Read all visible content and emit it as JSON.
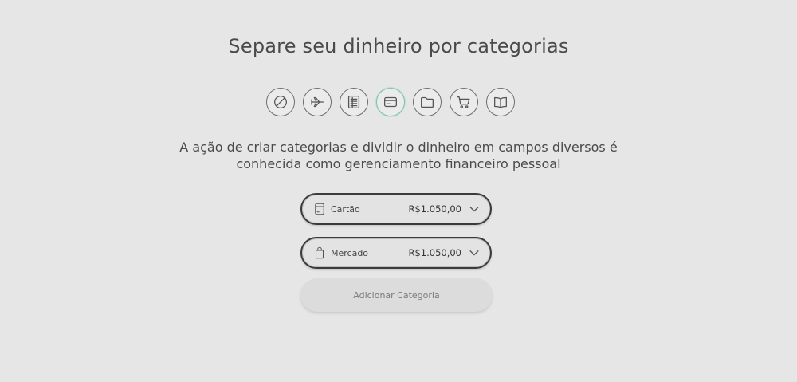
{
  "header": {
    "title": "Separe seu dinheiro por categorias"
  },
  "icon_picker": {
    "icons": [
      {
        "name": "blocked-icon",
        "selected": false
      },
      {
        "name": "airplane-icon",
        "selected": false
      },
      {
        "name": "list-icon",
        "selected": false
      },
      {
        "name": "credit-card-icon",
        "selected": true
      },
      {
        "name": "folder-icon",
        "selected": false
      },
      {
        "name": "shopping-cart-icon",
        "selected": false
      },
      {
        "name": "book-icon",
        "selected": false
      }
    ],
    "selected_color": "#7cc6ad"
  },
  "description": {
    "line1": "A ação de criar categorias e dividir o dinheiro em campos diversos é",
    "line2": "conhecida como gerenciamento financeiro pessoal"
  },
  "categories": [
    {
      "icon": "credit-card-icon",
      "name": "Cartão",
      "amount": "R$1.050,00"
    },
    {
      "icon": "shopping-bag-icon",
      "name": "Mercado",
      "amount": "R$1.050,00"
    }
  ],
  "actions": {
    "add_category_label": "Adicionar Categoria"
  }
}
